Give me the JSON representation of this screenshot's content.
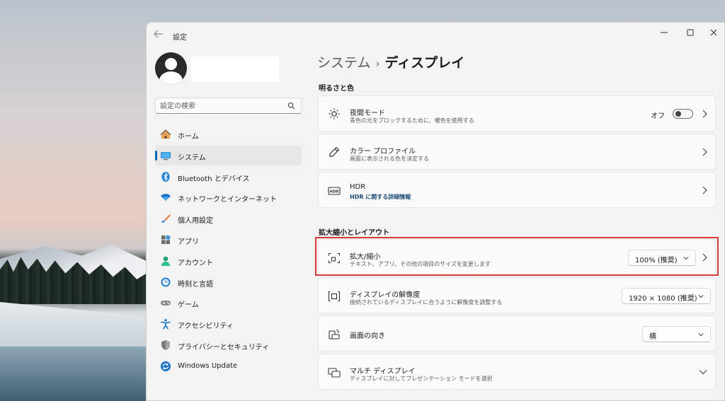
{
  "window": {
    "app_title": "設定",
    "back_icon": "back-arrow-icon",
    "controls": [
      "minimize-icon",
      "maximize-icon",
      "close-icon"
    ]
  },
  "search": {
    "placeholder": "設定の検索",
    "icon": "search-icon"
  },
  "sidebar": {
    "active_index": 1,
    "accent_color": "#0067c0",
    "items": [
      {
        "label": "ホーム",
        "icon": "home-icon"
      },
      {
        "label": "システム",
        "icon": "system-display-icon"
      },
      {
        "label": "Bluetooth とデバイス",
        "icon": "bluetooth-icon"
      },
      {
        "label": "ネットワークとインターネット",
        "icon": "wifi-icon"
      },
      {
        "label": "個人用設定",
        "icon": "brush-icon"
      },
      {
        "label": "アプリ",
        "icon": "apps-icon"
      },
      {
        "label": "アカウント",
        "icon": "account-icon"
      },
      {
        "label": "時刻と言語",
        "icon": "time-language-icon"
      },
      {
        "label": "ゲーム",
        "icon": "gamepad-icon"
      },
      {
        "label": "アクセシビリティ",
        "icon": "accessibility-icon"
      },
      {
        "label": "プライバシーとセキュリティ",
        "icon": "shield-icon"
      },
      {
        "label": "Windows Update",
        "icon": "windows-update-icon"
      }
    ]
  },
  "breadcrumb": {
    "parent": "システム",
    "separator": "›",
    "current": "ディスプレイ"
  },
  "sections": {
    "brightness_color": "明るさと色",
    "scale_layout": "拡大縮小とレイアウト"
  },
  "cards": {
    "night_light": {
      "title": "夜間モード",
      "subtitle": "青色の光をブロックするために、暖色を使用する",
      "toggle_label": "オフ",
      "toggle_on": false,
      "icon": "brightness-sun-icon"
    },
    "color_profile": {
      "title": "カラー プロファイル",
      "subtitle": "画面に表示される色を決定する",
      "icon": "eyedropper-icon"
    },
    "hdr": {
      "title": "HDR",
      "subtitle": "HDR に関する詳細情報",
      "icon": "hdr-icon"
    },
    "scale": {
      "title": "拡大/縮小",
      "subtitle": "テキスト、アプリ、その他の項目のサイズを変更します",
      "value": "100% (推奨)",
      "icon": "scale-icon",
      "highlighted": true,
      "highlight_color": "#d83a3a"
    },
    "resolution": {
      "title": "ディスプレイの解像度",
      "subtitle": "接続されているディスプレイに合うように解像度を調整する",
      "value": "1920 × 1080 (推奨)",
      "icon": "resolution-icon"
    },
    "orientation": {
      "title": "画面の向き",
      "value": "横",
      "icon": "orientation-icon"
    },
    "multi_display": {
      "title": "マルチ ディスプレイ",
      "subtitle": "ディスプレイに対してプレゼンテーション モードを選択",
      "icon": "multi-display-icon"
    }
  }
}
